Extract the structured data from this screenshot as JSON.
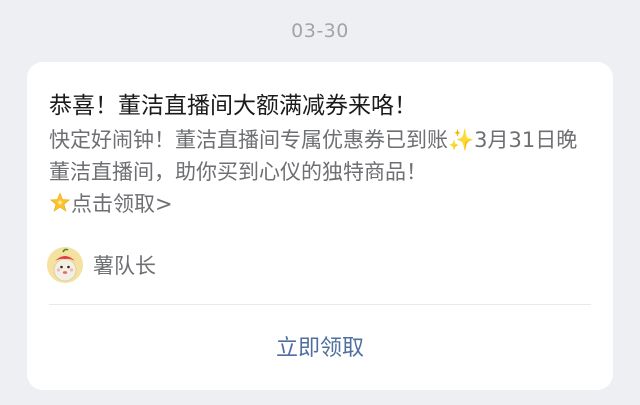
{
  "date": "03-30",
  "message": {
    "title": "恭喜！董洁直播间大额满减券来咯！",
    "body_part1": "快定好闹钟！董洁直播间专属优惠券已到账",
    "sparkle": "✨",
    "body_part2": "3月31日晚董洁直播间，助你买到心仪的独特商品！",
    "cta_inline": "点击领取>",
    "sender_name": "薯队长",
    "action_label": "立即领取"
  },
  "colors": {
    "background": "#eeeff3",
    "card": "#ffffff",
    "title": "#1b1b1b",
    "body": "#6e6f73",
    "link": "#4f6f9f"
  },
  "icons": {
    "sparkle": "sparkles-emoji",
    "star": "glowing-star-emoji",
    "avatar": "potato-mascot-avatar"
  }
}
